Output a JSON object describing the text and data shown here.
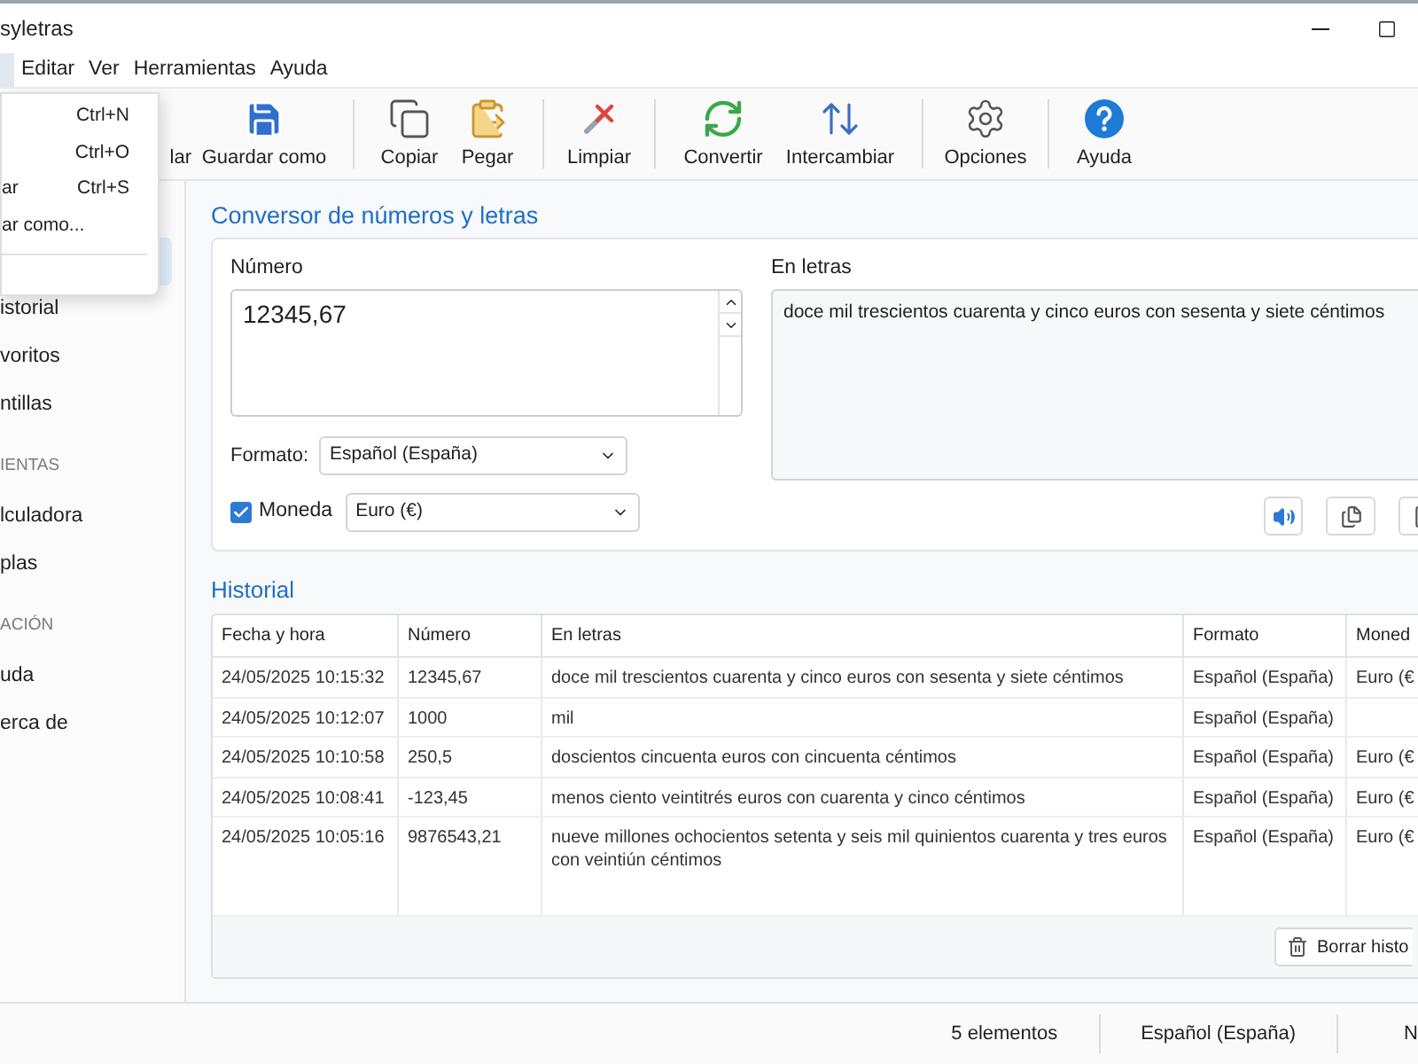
{
  "window": {
    "title": "syletras"
  },
  "menu_bar": [
    {
      "open": true
    },
    {
      "label": "Editar",
      "open": false
    },
    {
      "label": "Ver",
      "open": false
    },
    {
      "label": "Herramientas",
      "open": false
    },
    {
      "label": "Ayuda",
      "open": false
    }
  ],
  "open_menu": {
    "items": [
      {
        "shortcut": "Ctrl+N"
      },
      {
        "shortcut": "Ctrl+O"
      },
      {
        "label": "ar",
        "shortcut": "Ctrl+S"
      },
      {
        "label": "ar como..."
      }
    ]
  },
  "toolbar": {
    "groups": [
      [
        {
          "label": "lar"
        },
        {
          "label": "Guardar como"
        }
      ],
      [
        {
          "label": "Copiar"
        },
        {
          "label": "Pegar"
        }
      ],
      [
        {
          "label": "Limpiar"
        }
      ],
      [
        {
          "label": "Convertir"
        },
        {
          "label": "Intercambiar"
        }
      ],
      [
        {
          "label": "Opciones"
        }
      ],
      [
        {
          "label": "Ayuda"
        }
      ]
    ]
  },
  "sidebar": {
    "sections": [
      {
        "items": [
          {
            "selected": true
          },
          {
            "label": "istorial",
            "selected": false
          },
          {
            "label": "voritos",
            "selected": false
          },
          {
            "label": "ntillas",
            "selected": false
          }
        ]
      },
      {
        "header": "IENTAS",
        "items": [
          {
            "label": "lculadora",
            "selected": false
          },
          {
            "label": "plas",
            "selected": false
          }
        ]
      },
      {
        "header": "ACIÓN",
        "items": [
          {
            "label": "uda",
            "selected": false
          },
          {
            "label": "erca de",
            "selected": false
          }
        ]
      }
    ]
  },
  "converter": {
    "title": "Conversor de números y letras",
    "number_label": "Número",
    "number_value": "12345,67",
    "words_label": "En letras",
    "words_value": "doce mil trescientos cuarenta y cinco euros con sesenta y siete céntimos",
    "format_label": "Formato:",
    "format_value": "Español (España)",
    "currency": {
      "label": "Moneda",
      "checked": true,
      "value": "Euro (€)"
    }
  },
  "history": {
    "title": "Historial",
    "columns": [
      "Fecha y hora",
      "Número",
      "En letras",
      "Formato",
      "Moned"
    ],
    "rows": [
      [
        "24/05/2025 10:15:32",
        "12345,67",
        "doce mil trescientos cuarenta y cinco euros con sesenta y siete céntimos",
        "Español (España)",
        "Euro (€"
      ],
      [
        "24/05/2025 10:12:07",
        "1000",
        "mil",
        "Español (España)"
      ],
      [
        "24/05/2025 10:10:58",
        "250,5",
        "doscientos cincuenta euros con cincuenta céntimos",
        "Español (España)",
        "Euro (€"
      ],
      [
        "24/05/2025 10:08:41",
        "-123,45",
        "menos ciento veintitrés euros con cuarenta y cinco céntimos",
        "Español (España)",
        "Euro (€"
      ],
      [
        "24/05/2025 10:05:16",
        "9876543,21",
        "nueve millones ochocientos setenta y seis mil quinientos cuarenta y tres euros con veintiún céntimos",
        "Español (España)",
        "Euro (€"
      ]
    ],
    "clear_button": "Borrar histo"
  },
  "status_bar": [
    "5 elementos",
    "Español (España)",
    "N"
  ]
}
